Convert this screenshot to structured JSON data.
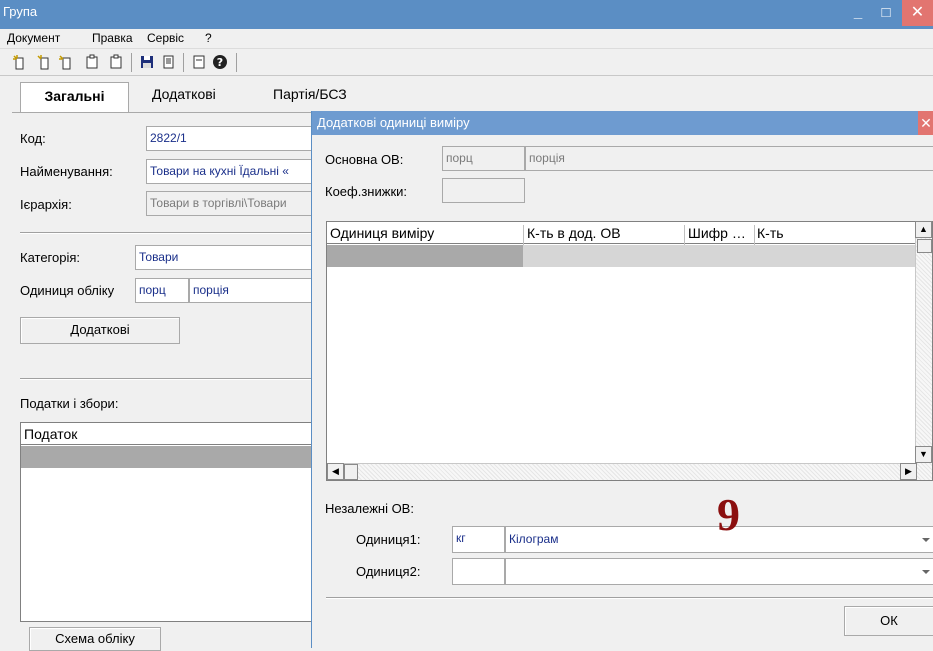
{
  "window": {
    "title": "Група",
    "controls": {
      "minimize": "_",
      "maximize": "□",
      "close": "✕"
    }
  },
  "menu": {
    "items": [
      "Документ",
      "Правка",
      "Сервіс",
      "?"
    ]
  },
  "toolbar": {
    "icons": [
      "new-icon",
      "new-copy-icon",
      "new-group-icon",
      "new-subgroup-icon",
      "add-icon",
      "save-icon",
      "report-icon",
      "form-icon",
      "help-icon"
    ]
  },
  "tabs": [
    {
      "label": "Загальні",
      "active": true
    },
    {
      "label": "Додаткові",
      "active": false
    },
    {
      "label": "Партія/БСЗ",
      "active": false
    }
  ],
  "general": {
    "code_label": "Код:",
    "code_value": "2822/1",
    "name_label": "Найменування:",
    "name_value": "Товари на кухні Їдальні «",
    "hierarchy_label": "Ієрархія:",
    "hierarchy_value": "Товари в  торгівлі\\Товари",
    "category_label": "Категорія:",
    "category_value": "Товари",
    "unit_label": "Одиниця обліку",
    "unit_code": "порц",
    "unit_name": "порція",
    "additional_button": "Додаткові",
    "taxes_label": "Податки і збори:",
    "taxes_grid": {
      "columns": [
        "Податок"
      ]
    },
    "accounting_scheme_button": "Схема обліку"
  },
  "dialog": {
    "title": "Додаткові одиниці виміру",
    "close": "✕",
    "base_unit_label": "Основна ОВ:",
    "base_unit_code": "порц",
    "base_unit_name": "порція",
    "discount_coef_label": "Коеф.знижки:",
    "discount_coef_value": "",
    "grid": {
      "columns": [
        "Одиниця виміру",
        "К-ть в дод. ОВ",
        "Шифр …",
        "К-ть"
      ]
    },
    "independent_label": "Незалежні ОВ:",
    "unit1_label": "Одиниця1:",
    "unit1_code": "кг",
    "unit1_name": "Кілограм",
    "unit2_label": "Одиниця2:",
    "unit2_code": "",
    "unit2_name": "",
    "ok_button": "ОК",
    "step_badge": "9"
  },
  "colors": {
    "titlebar": "#5b8ec4",
    "dialog_titlebar": "#6e9bd0",
    "close_button": "#e27570",
    "field_text": "#1a2f8a",
    "badge": "#8b0f0f",
    "grid_selection": "#a9a9a9"
  }
}
